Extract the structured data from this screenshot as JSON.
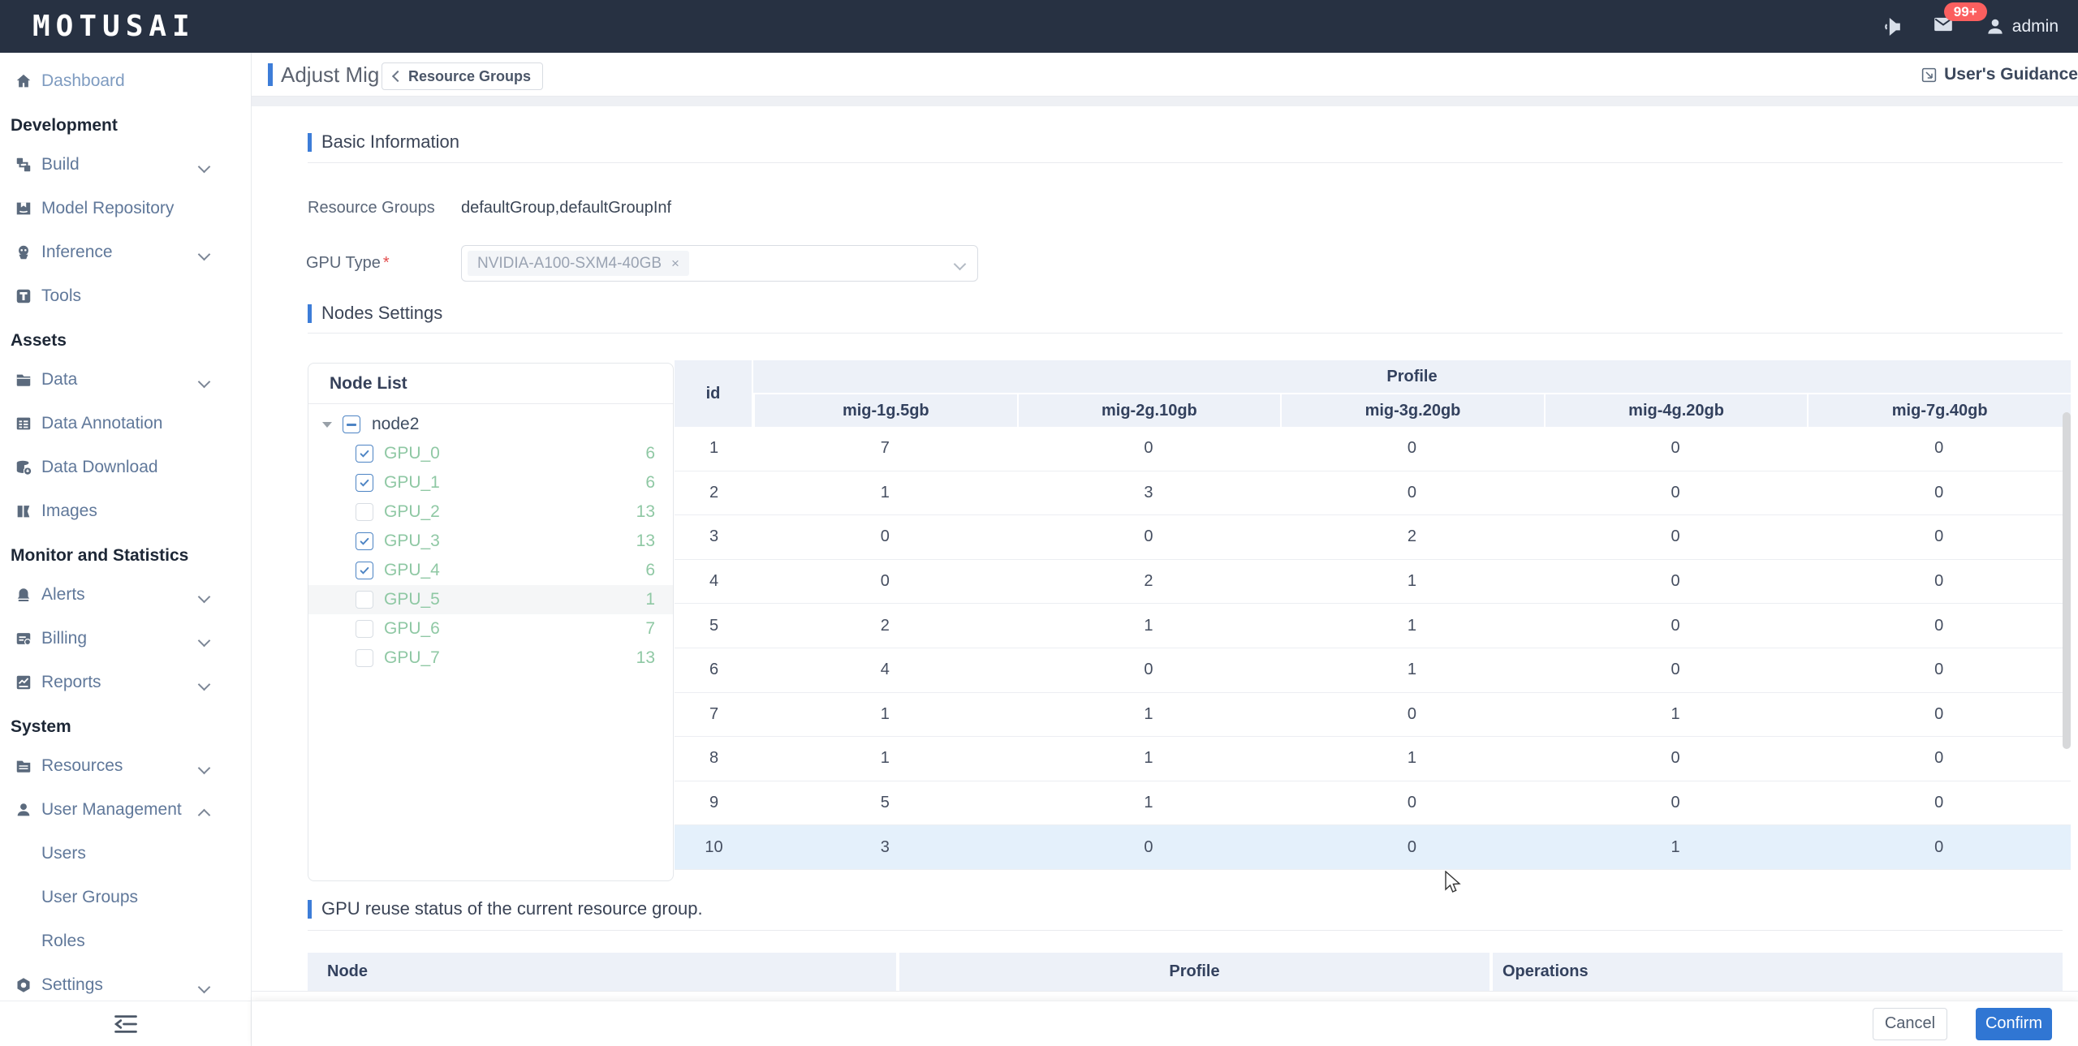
{
  "topbar": {
    "logo": "MOTUSAI",
    "badge": "99+",
    "user": "admin"
  },
  "page_header": {
    "title": "Adjust Mig",
    "back_label": "Resource Groups",
    "guidance": "User's Guidance"
  },
  "sidebar": {
    "dashboard": "Dashboard",
    "sections": {
      "development": "Development",
      "assets": "Assets",
      "monitor": "Monitor and Statistics",
      "system": "System"
    },
    "build": "Build",
    "model_repository": "Model Repository",
    "inference": "Inference",
    "tools": "Tools",
    "data": "Data",
    "data_annotation": "Data Annotation",
    "data_download": "Data Download",
    "images": "Images",
    "alerts": "Alerts",
    "billing": "Billing",
    "reports": "Reports",
    "resources": "Resources",
    "user_management": "User Management",
    "users": "Users",
    "user_groups": "User Groups",
    "roles": "Roles",
    "settings": "Settings"
  },
  "basic_info": {
    "title": "Basic Information",
    "resource_groups_label": "Resource Groups",
    "resource_groups_value": "defaultGroup,defaultGroupInf",
    "gpu_type_label": "GPU Type",
    "gpu_type_tag": "NVIDIA-A100-SXM4-40GB",
    "tag_remove": "×"
  },
  "nodes_settings": {
    "title": "Nodes Settings",
    "node_list_title": "Node List",
    "parent_node": "node2",
    "gpus": [
      {
        "label": "GPU_0",
        "count": 6,
        "checked": true,
        "hover": false
      },
      {
        "label": "GPU_1",
        "count": 6,
        "checked": true,
        "hover": false
      },
      {
        "label": "GPU_2",
        "count": 13,
        "checked": false,
        "hover": false
      },
      {
        "label": "GPU_3",
        "count": 13,
        "checked": true,
        "hover": false
      },
      {
        "label": "GPU_4",
        "count": 6,
        "checked": true,
        "hover": false
      },
      {
        "label": "GPU_5",
        "count": 1,
        "checked": false,
        "hover": true
      },
      {
        "label": "GPU_6",
        "count": 7,
        "checked": false,
        "hover": false
      },
      {
        "label": "GPU_7",
        "count": 13,
        "checked": false,
        "hover": false
      }
    ]
  },
  "mig_table": {
    "id_header": "id",
    "group_header": "Profile",
    "profile_columns": [
      "mig-1g.5gb",
      "mig-2g.10gb",
      "mig-3g.20gb",
      "mig-4g.20gb",
      "mig-7g.40gb"
    ],
    "rows": [
      {
        "id": 1,
        "c0": 7,
        "c1": 0,
        "c2": 0,
        "c3": 0,
        "c4": 0,
        "highlight": false
      },
      {
        "id": 2,
        "c0": 1,
        "c1": 3,
        "c2": 0,
        "c3": 0,
        "c4": 0,
        "highlight": false
      },
      {
        "id": 3,
        "c0": 0,
        "c1": 0,
        "c2": 2,
        "c3": 0,
        "c4": 0,
        "highlight": false
      },
      {
        "id": 4,
        "c0": 0,
        "c1": 2,
        "c2": 1,
        "c3": 0,
        "c4": 0,
        "highlight": false
      },
      {
        "id": 5,
        "c0": 2,
        "c1": 1,
        "c2": 1,
        "c3": 0,
        "c4": 0,
        "highlight": false
      },
      {
        "id": 6,
        "c0": 4,
        "c1": 0,
        "c2": 1,
        "c3": 0,
        "c4": 0,
        "highlight": false
      },
      {
        "id": 7,
        "c0": 1,
        "c1": 1,
        "c2": 0,
        "c3": 1,
        "c4": 0,
        "highlight": false
      },
      {
        "id": 8,
        "c0": 1,
        "c1": 1,
        "c2": 1,
        "c3": 0,
        "c4": 0,
        "highlight": false
      },
      {
        "id": 9,
        "c0": 5,
        "c1": 1,
        "c2": 0,
        "c3": 0,
        "c4": 0,
        "highlight": false
      },
      {
        "id": 10,
        "c0": 3,
        "c1": 0,
        "c2": 0,
        "c3": 1,
        "c4": 0,
        "highlight": true
      }
    ]
  },
  "reuse_section": {
    "title": "GPU reuse status of the current resource group.",
    "col_node": "Node",
    "col_profile": "Profile",
    "col_operations": "Operations"
  },
  "footer": {
    "cancel": "Cancel",
    "confirm": "Confirm"
  },
  "colors": {
    "accent": "#3d7dd8",
    "confirm_blue": "#3076d3",
    "badge_red": "#fb5f5f",
    "gpu_green": "#8fc8a4",
    "topbar_navy": "#273142"
  }
}
